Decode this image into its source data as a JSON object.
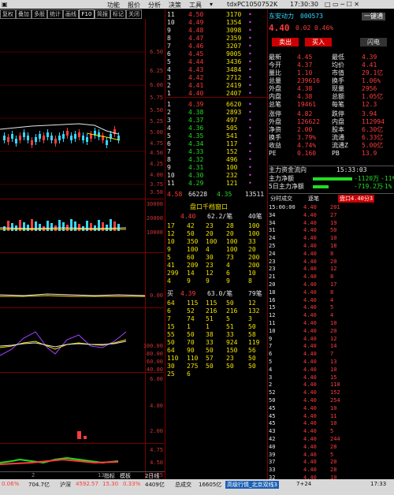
{
  "app": {
    "menu": [
      "功能",
      "报价",
      "分析",
      "决策",
      "工具"
    ],
    "window_title": "tdxPC1050752K",
    "clock": "17:30:30"
  },
  "chart_tabs": [
    "复权",
    "叠加",
    "多股",
    "统计",
    "画线",
    "F10",
    "简报",
    "标记",
    "关闭"
  ],
  "chart": {
    "price_axis": [
      "6.50",
      "6.25",
      "6.00",
      "5.75",
      "5.50",
      "5.25",
      "5.00",
      "4.75",
      "4.50",
      "4.25",
      "4.00",
      "3.75",
      "3.50"
    ],
    "volume_axis": [
      "30000",
      "20000",
      "10000"
    ],
    "macd_axis": [
      "0.00"
    ],
    "kdj_axis": [
      "100.00",
      "80.00",
      "60.00",
      "40.00",
      "20.00"
    ],
    "extra_axis": [
      "6.00",
      "4.00",
      "2.00"
    ],
    "lower_axis": [
      "4.75",
      "4.50",
      "4.25"
    ],
    "bottom_left": "2",
    "bottom_mid": "13",
    "bottom_buttons": [
      "指标",
      "模板",
      "2日线"
    ]
  },
  "order_book": {
    "sell": [
      {
        "level": "11",
        "price": "4.50",
        "vol": "3170",
        "mark": "•"
      },
      {
        "level": "10",
        "price": "4.49",
        "vol": "1354",
        "mark": "•"
      },
      {
        "level": "9",
        "price": "4.48",
        "vol": "3098",
        "mark": "•"
      },
      {
        "level": "8",
        "price": "4.47",
        "vol": "2359",
        "mark": "•"
      },
      {
        "level": "7",
        "price": "4.46",
        "vol": "3207",
        "mark": "•"
      },
      {
        "level": "6",
        "price": "4.45",
        "vol": "9005",
        "mark": "•"
      },
      {
        "level": "5",
        "price": "4.44",
        "vol": "3436",
        "mark": "•"
      },
      {
        "level": "4",
        "price": "4.43",
        "vol": "3484",
        "mark": "•"
      },
      {
        "level": "3",
        "price": "4.42",
        "vol": "2712",
        "mark": "•"
      },
      {
        "level": "2",
        "price": "4.41",
        "vol": "2419",
        "mark": "•"
      },
      {
        "level": "1",
        "price": "4.40",
        "vol": "2407",
        "mark": "•"
      }
    ],
    "buy": [
      {
        "level": "1",
        "price": "4.39",
        "vol": "6620",
        "mark": "•"
      },
      {
        "level": "2",
        "price": "4.38",
        "vol": "2893",
        "mark": "•"
      },
      {
        "level": "3",
        "price": "4.37",
        "vol": "497",
        "mark": "•"
      },
      {
        "level": "4",
        "price": "4.36",
        "vol": "505",
        "mark": "•"
      },
      {
        "level": "5",
        "price": "4.35",
        "vol": "541",
        "mark": "•"
      },
      {
        "level": "6",
        "price": "4.34",
        "vol": "117",
        "mark": "•"
      },
      {
        "level": "7",
        "price": "4.33",
        "vol": "152",
        "mark": "•"
      },
      {
        "level": "8",
        "price": "4.32",
        "vol": "496",
        "mark": "•"
      },
      {
        "level": "9",
        "price": "4.31",
        "vol": "100",
        "mark": "•"
      },
      {
        "level": "10",
        "price": "4.30",
        "vol": "232",
        "mark": "•"
      },
      {
        "level": "11",
        "price": "4.29",
        "vol": "121",
        "mark": "•"
      }
    ],
    "summary": {
      "a": "4.58",
      "b": "66228",
      "c": "4.35",
      "d": "13511"
    },
    "queue_title": "盘口千档窗口",
    "sell_queue_header": {
      "price": "4.40",
      "info": "62.2/笔",
      "count": "40笔"
    },
    "sell_queue": [
      [
        "17",
        "42",
        "23",
        "28",
        "100"
      ],
      [
        "12",
        "50",
        "20",
        "20",
        "100"
      ],
      [
        "10",
        "350",
        "100",
        "100",
        "33"
      ],
      [
        "9",
        "100",
        "4",
        "100",
        "20"
      ],
      [
        "5",
        "60",
        "30",
        "73",
        "200"
      ],
      [
        "41",
        "209",
        "23",
        "4",
        "200"
      ],
      [
        "299",
        "14",
        "12",
        "6",
        "10"
      ],
      [
        "4",
        "9",
        "9",
        "9",
        "8"
      ]
    ],
    "buy_queue_header": {
      "side": "买",
      "price": "4.39",
      "info": "63.0/笔",
      "count": "79笔"
    },
    "buy_queue": [
      [
        "64",
        "115",
        "115",
        "50",
        "12"
      ],
      [
        "6",
        "52",
        "216",
        "216",
        "132"
      ],
      [
        "7",
        "74",
        "51",
        "5",
        "3"
      ],
      [
        "15",
        "1",
        "1",
        "51",
        "50"
      ],
      [
        "55",
        "50",
        "38",
        "33",
        "58"
      ],
      [
        "50",
        "70",
        "33",
        "924",
        "119"
      ],
      [
        "64",
        "90",
        "50",
        "150",
        "56"
      ],
      [
        "110",
        "110",
        "57",
        "23",
        "50"
      ],
      [
        "30",
        "275",
        "50",
        "50",
        "50"
      ],
      [
        "25",
        "6",
        "",
        "",
        ""
      ]
    ]
  },
  "quote": {
    "name": "东安动力",
    "code": "000573",
    "btn_one": "一键通",
    "price": "4.40",
    "change": "0.02",
    "pct": "0.46%",
    "sell_btn": "卖出",
    "buy_btn": "买入",
    "list_btn": "闪电",
    "rows": [
      {
        "l": "最新",
        "lv": "4.45",
        "r": "最低",
        "rv": "4.39"
      },
      {
        "l": "今开",
        "lv": "4.37",
        "r": "均价",
        "rv": "4.41"
      },
      {
        "l": "量比",
        "lv": "1.10",
        "r": "市值",
        "rv": "29.1亿"
      },
      {
        "l": "总量",
        "lv": "239616",
        "r": "换手",
        "rv": "1.06%"
      },
      {
        "l": "外盘",
        "lv": "4.38",
        "r": "现量",
        "rv": "2956"
      },
      {
        "l": "内盘",
        "lv": "4.38",
        "r": "总额",
        "rv": "1.05亿"
      },
      {
        "l": "总笔",
        "lv": "19461",
        "r": "每笔",
        "rv": "12.3"
      }
    ],
    "rows2": [
      {
        "l": "涨停",
        "lv": "4.82",
        "r": "跌停",
        "rv": "3.94"
      },
      {
        "l": "外盘",
        "lv": "126622",
        "r": "内盘",
        "rv": "112994"
      },
      {
        "l": "净资",
        "lv": "2.00",
        "r": "股本",
        "rv": "6.30亿"
      },
      {
        "l": "换手",
        "lv": "3.79%",
        "r": "流通",
        "rv": "6.33亿"
      },
      {
        "l": "收益",
        "lv": "4.74%",
        "r": "流通Z",
        "rv": "5.00亿"
      },
      {
        "l": "PE",
        "lv": "0.160",
        "r": "PB",
        "rv": "13.9"
      }
    ],
    "fund_title": "主力资金流向",
    "fund_time": "15:33:03",
    "fund_rows": [
      {
        "label": "主力净额",
        "val": "-1120万",
        "pct": "-11%"
      },
      {
        "label": "5日主力净额",
        "val": "-719.2万",
        "pct": "-1%"
      }
    ]
  },
  "ticks": {
    "tabs": [
      "分时成交",
      "逐笔",
      "盘口4.40分3"
    ],
    "rows": [
      [
        "15:00:00",
        "4.40",
        "201"
      ],
      [
        "34",
        "4.40",
        "27"
      ],
      [
        "34",
        "4.40",
        "19"
      ],
      [
        "31",
        "4.40",
        "50"
      ],
      [
        "24",
        "4.40",
        "10"
      ],
      [
        "25",
        "4.40",
        "18"
      ],
      [
        "24",
        "4.40",
        "8"
      ],
      [
        "23",
        "4.40",
        "20"
      ],
      [
        "23",
        "4.40",
        "12"
      ],
      [
        "21",
        "4.40",
        "8"
      ],
      [
        "20",
        "4.40",
        "17"
      ],
      [
        "18",
        "4.40",
        "8"
      ],
      [
        "16",
        "4.40",
        "4"
      ],
      [
        "15",
        "4.40",
        "5"
      ],
      [
        "12",
        "4.40",
        "4"
      ],
      [
        "11",
        "4.40",
        "10"
      ],
      [
        "10",
        "4.40",
        "20"
      ],
      [
        "9",
        "4.40",
        "12"
      ],
      [
        "7",
        "4.40",
        "14"
      ],
      [
        "6",
        "4.40",
        "7"
      ],
      [
        "5",
        "4.40",
        "13"
      ],
      [
        "4",
        "4.40",
        "10"
      ],
      [
        "3",
        "4.40",
        "15"
      ],
      [
        "2",
        "4.40",
        "110"
      ],
      [
        "52",
        "4.40",
        "152"
      ],
      [
        "50",
        "4.40",
        "254"
      ],
      [
        "45",
        "4.40",
        "10"
      ],
      [
        "45",
        "4.40",
        "11"
      ],
      [
        "45",
        "4.40",
        "10"
      ],
      [
        "43",
        "4.40",
        "5"
      ],
      [
        "42",
        "4.40",
        "244"
      ],
      [
        "40",
        "4.40",
        "28"
      ],
      [
        "39",
        "4.40",
        "5"
      ],
      [
        "37",
        "4.40",
        "20"
      ],
      [
        "33",
        "4.40",
        "28"
      ],
      [
        "32",
        "4.40",
        "10"
      ]
    ]
  },
  "status": {
    "items": [
      "0.06%",
      "704.7亿",
      "沪深",
      "4592.57",
      "15.30",
      "0.33%",
      "4409亿",
      "总成交",
      "16605亿",
      "高级行情_北京双线3",
      "7+24"
    ],
    "right": "17:33"
  },
  "colors": {
    "up": "#ff3b3b",
    "down": "#22dd22",
    "accent": "#f0e000",
    "grid": "#7a0000"
  }
}
